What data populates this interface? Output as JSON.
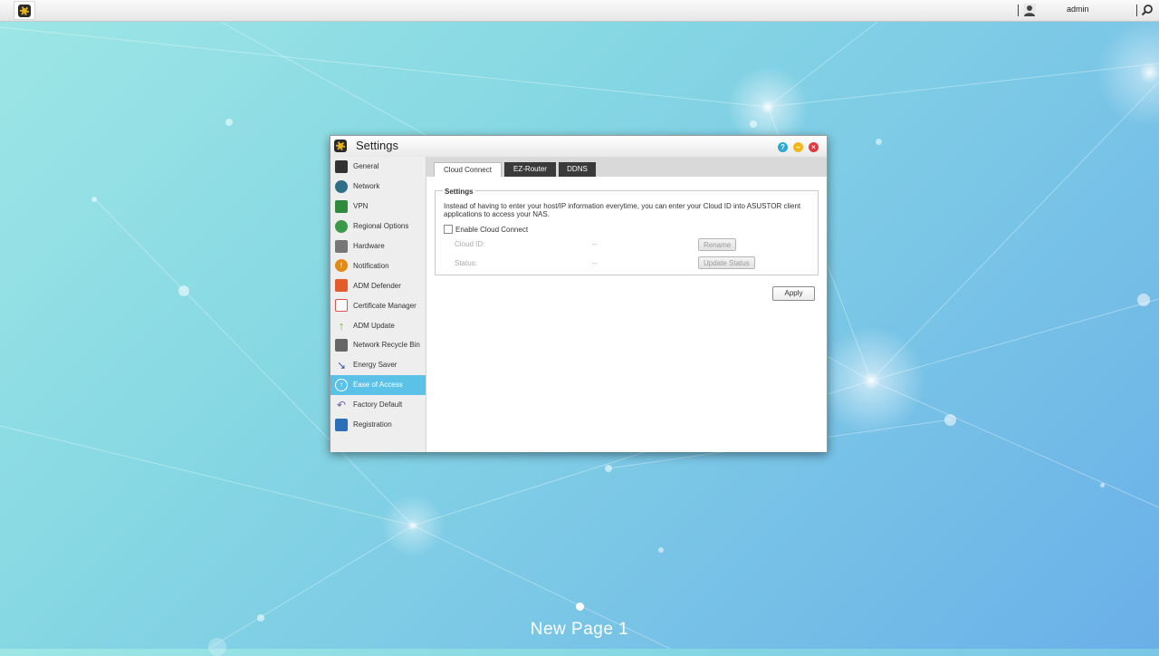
{
  "topbar": {
    "user_name": "admin"
  },
  "window": {
    "title": "Settings",
    "help_label": "?",
    "minimize_label": "–",
    "close_label": "×"
  },
  "sidebar": {
    "items": [
      {
        "label": "General",
        "icon": "general-icon",
        "color": "#333333"
      },
      {
        "label": "Network",
        "icon": "network-globe-icon",
        "color": "#2c6f86"
      },
      {
        "label": "VPN",
        "icon": "vpn-icon",
        "color": "#2f8a3b"
      },
      {
        "label": "Regional Options",
        "icon": "regional-options-icon",
        "color": "#3a9a47"
      },
      {
        "label": "Hardware",
        "icon": "hardware-icon",
        "color": "#777777"
      },
      {
        "label": "Notification",
        "icon": "notification-icon",
        "color": "#e38a13"
      },
      {
        "label": "ADM Defender",
        "icon": "adm-defender-icon",
        "color": "#e25b2b"
      },
      {
        "label": "Certificate Manager",
        "icon": "certificate-icon",
        "color": "#d9534f"
      },
      {
        "label": "ADM Update",
        "icon": "adm-update-icon",
        "color": "#6bb82a"
      },
      {
        "label": "Network Recycle Bin",
        "icon": "recycle-bin-icon",
        "color": "#666666"
      },
      {
        "label": "Energy Saver",
        "icon": "energy-saver-icon",
        "color": "#2e55b0"
      },
      {
        "label": "Ease of Access",
        "icon": "ease-of-access-icon",
        "color": "#ffffff"
      },
      {
        "label": "Factory Default",
        "icon": "factory-default-icon",
        "color": "#6a5aa8"
      },
      {
        "label": "Registration",
        "icon": "registration-icon",
        "color": "#2a6fb8"
      }
    ],
    "active_index": 11
  },
  "tabs": [
    {
      "label": "Cloud Connect"
    },
    {
      "label": "EZ-Router"
    },
    {
      "label": "DDNS"
    }
  ],
  "settings_group": {
    "legend": "Settings",
    "description": "Instead of having to enter your host/IP information everytime, you can enter your Cloud ID into ASUSTOR client applications to access your NAS.",
    "enable_label": "Enable Cloud Connect",
    "cloud_id_label": "Cloud ID:",
    "cloud_id_value": "--",
    "rename_label": "Rename",
    "status_label": "Status:",
    "status_value": "--",
    "update_status_label": "Update Status"
  },
  "apply_label": "Apply",
  "desktop": {
    "page_label": "New Page 1"
  },
  "colors": {
    "accent": "#5bc1e6",
    "tab_dark": "#3a3a3a"
  }
}
